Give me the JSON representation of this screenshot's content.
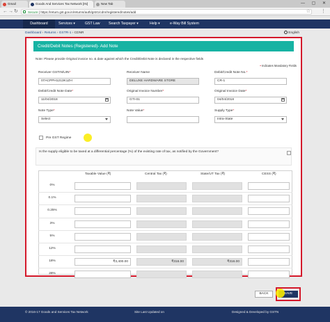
{
  "browser": {
    "tabs": [
      {
        "label": "Gmail",
        "color": "#db4437"
      },
      {
        "label": "Goods And Services Tax Network [IN]",
        "color": "#1f3563"
      },
      {
        "label": "New Tab",
        "color": "#999999"
      }
    ],
    "url_secure": "Secure",
    "url": "https://return.gst.gov.in/returns/auth/gstr1/cdnr/registered/notes/add",
    "window_controls": "— ▢ ✕"
  },
  "nav": {
    "items": [
      "Dashboard",
      "Services ▾",
      "GST Law",
      "Search Taxpayer ▾",
      "Help ▾",
      "e-Way Bill System"
    ]
  },
  "breadcrumb": {
    "items": [
      "Dashboard",
      "Returns",
      "GSTR-1",
      "CDNR"
    ],
    "separator": " › ",
    "language": "English"
  },
  "form": {
    "title": "Credit/Debit Notes (Registered)- Add Note",
    "note": "Note: Please provide Original invoice no. & date against which the Credit/Debit Note is declared in the respective fields",
    "mandatory": "Indicates Mandatory Fields",
    "fields": {
      "receiver_gstin": {
        "label": "Receiver GSTIN/UIN",
        "value": "07ACPPH1213K1ZH"
      },
      "receiver_name": {
        "label": "Receiver Name",
        "value": "DELUXE HARDWARE STORE"
      },
      "note_no": {
        "label": "Debit/Credit Note No.",
        "value": "CR-1"
      },
      "note_date": {
        "label": "Debit/Credit Note Date",
        "value": "11/04/2018"
      },
      "orig_invoice_no": {
        "label": "Original Invoice Number",
        "value": "GTI-01"
      },
      "orig_invoice_date": {
        "label": "Original Invoice Date",
        "value": "04/04/2018"
      },
      "note_type": {
        "label": "Note Type",
        "value": "Select"
      },
      "note_value": {
        "label": "Note Value",
        "value": ""
      },
      "supply_type": {
        "label": "Supply Type",
        "value": "Intra-State"
      }
    },
    "pre_gst": "Pre GST Regime",
    "differential_question": "Is the supply eligible to be taxed at a differential percentage (%) of the existing rate of tax, as notified by the Government?"
  },
  "rates_table": {
    "headers": {
      "taxable": "Taxable Value (₹)",
      "central": "Central Tax (₹)",
      "state": "State/UT Tax (₹)",
      "cess": "CESS (₹)"
    },
    "rows": [
      {
        "rate": "0%",
        "taxable": "",
        "central": "",
        "state": "",
        "cess": ""
      },
      {
        "rate": "0.1%",
        "taxable": "",
        "central": "",
        "state": "",
        "cess": ""
      },
      {
        "rate": "0.25%",
        "taxable": "",
        "central": "",
        "state": "",
        "cess": ""
      },
      {
        "rate": "3%",
        "taxable": "",
        "central": "",
        "state": "",
        "cess": ""
      },
      {
        "rate": "5%",
        "taxable": "",
        "central": "",
        "state": "",
        "cess": ""
      },
      {
        "rate": "12%",
        "taxable": "",
        "central": "",
        "state": "",
        "cess": ""
      },
      {
        "rate": "18%",
        "taxable": "₹3,400.00",
        "central": "₹316.00",
        "state": "₹316.00",
        "cess": ""
      },
      {
        "rate": "28%",
        "taxable": "",
        "central": "",
        "state": "",
        "cess": ""
      }
    ]
  },
  "buttons": {
    "back": "BACK",
    "save": "SAVE"
  },
  "footer": {
    "copyright": "© 2016-17 Goods and Services Tax Network",
    "updated": "Site Last Updated on",
    "designed": "Designed & Developed by GSTN"
  }
}
